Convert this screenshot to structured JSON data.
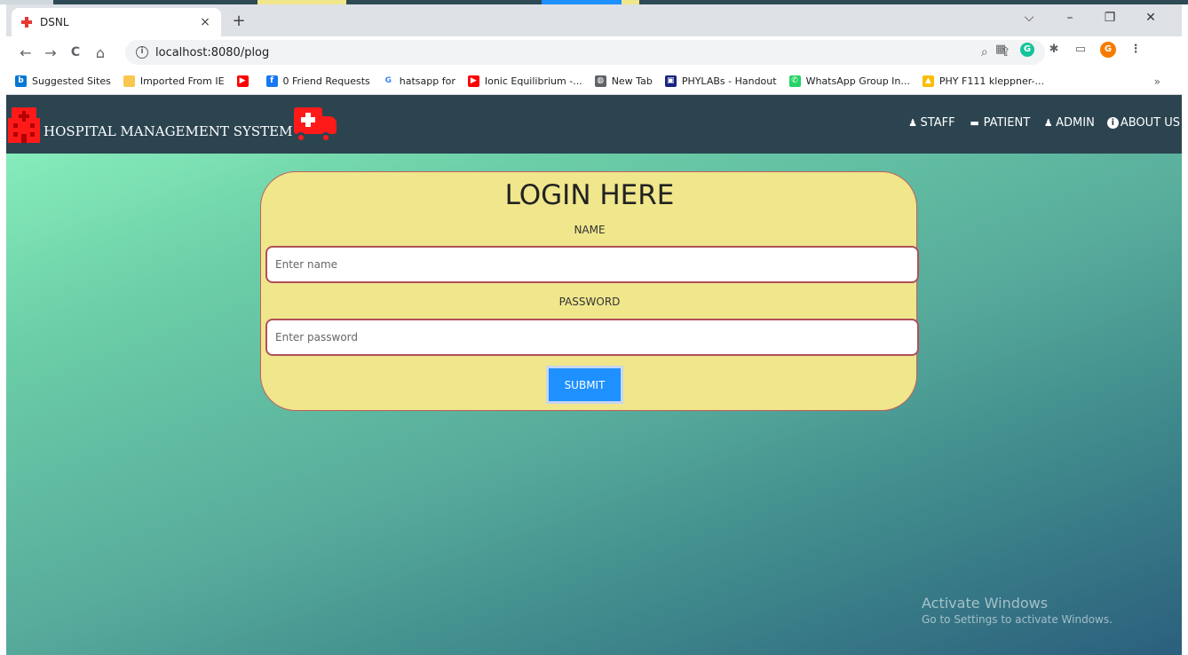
{
  "browser": {
    "tab_title": "DSNL",
    "tab_close": "×",
    "new_tab": "+",
    "url": "localhost:8080/plog",
    "controls": {
      "dropdown": "⌵",
      "minimize": "–",
      "restore": "❐",
      "close": "✕"
    },
    "nav": {
      "back": "←",
      "forward": "→",
      "reload": "C",
      "home": "⌂"
    },
    "bookmarks": [
      {
        "label": "Suggested Sites",
        "icon": "bing-icon",
        "color": "#0078d4",
        "glyph": "b"
      },
      {
        "label": "Imported From IE",
        "icon": "folder-icon",
        "color": "#f9c74f",
        "glyph": ""
      },
      {
        "label": "",
        "icon": "youtube-icon",
        "color": "#ff0000",
        "glyph": "▶"
      },
      {
        "label": "0 Friend Requests",
        "icon": "facebook-icon",
        "color": "#1877f2",
        "glyph": "f"
      },
      {
        "label": "hatsapp for",
        "icon": "google-icon",
        "color": "#ffffff",
        "glyph": "G"
      },
      {
        "label": "Ionic Equilibrium -...",
        "icon": "youtube-icon",
        "color": "#ff0000",
        "glyph": "▶"
      },
      {
        "label": "New Tab",
        "icon": "globe-icon",
        "color": "#5f6368",
        "glyph": "◍"
      },
      {
        "label": "PHYLABs - Handout",
        "icon": "bits-logo-icon",
        "color": "#1a237e",
        "glyph": "▣"
      },
      {
        "label": "WhatsApp Group In...",
        "icon": "whatsapp-icon",
        "color": "#25d366",
        "glyph": "✆"
      },
      {
        "label": "PHY F111 kleppner-...",
        "icon": "drive-icon",
        "color": "#fbbc04",
        "glyph": "▲"
      }
    ],
    "bookmarks_more": "»",
    "profile_initial": "G"
  },
  "site": {
    "brand": "HOSPITAL MANAGEMENT SYSTEM",
    "nav": [
      {
        "label": "STAFF",
        "icon": "user-icon"
      },
      {
        "label": "PATIENT",
        "icon": "bed-icon"
      },
      {
        "label": "ADMIN",
        "icon": "user-icon"
      },
      {
        "label": "ABOUT US",
        "icon": "info-icon"
      }
    ]
  },
  "login": {
    "title": "LOGIN HERE",
    "name_label": "NAME",
    "name_placeholder": "Enter name",
    "password_label": "PASSWORD",
    "password_placeholder": "Enter password",
    "submit": "SUBMIT"
  },
  "watermark": {
    "line1": "Activate Windows",
    "line2": "Go to Settings to activate Windows."
  },
  "colors": {
    "navbar": "#2b4450",
    "card": "#f0e68c",
    "card_border": "#c0605a",
    "submit": "#1e90ff",
    "icon_red": "#ff1a1a"
  }
}
